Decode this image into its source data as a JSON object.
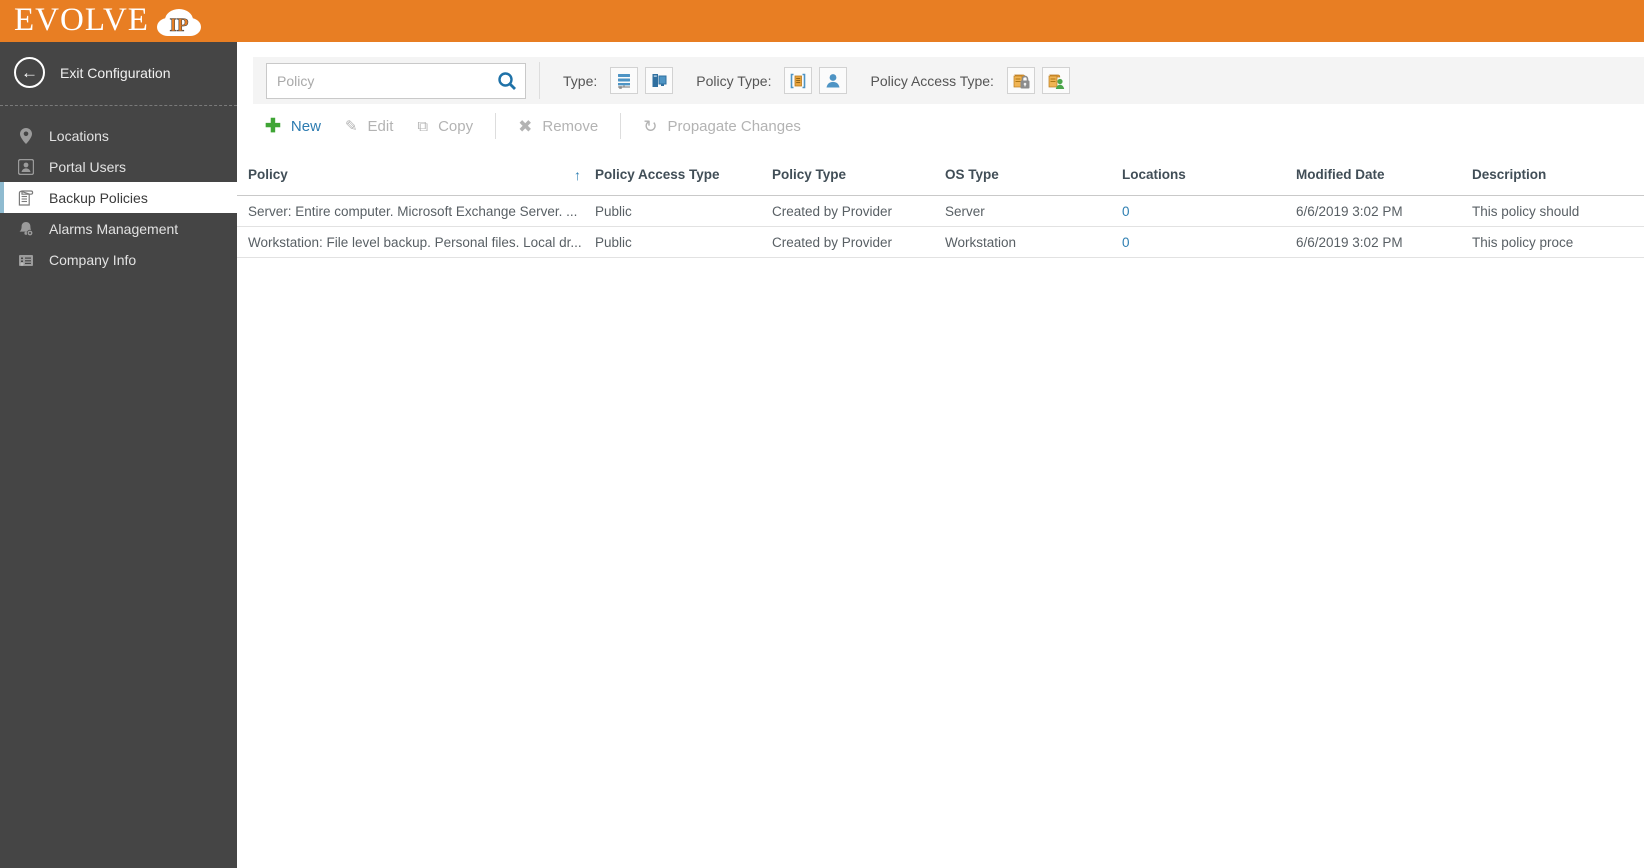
{
  "brand": {
    "logo_text": "EVOLVE",
    "logo_badge": "IP"
  },
  "sidebar": {
    "exit_label": "Exit Configuration",
    "items": [
      {
        "label": "Locations",
        "icon": "location-pin-icon",
        "selected": false
      },
      {
        "label": "Portal Users",
        "icon": "portal-user-icon",
        "selected": false
      },
      {
        "label": "Backup Policies",
        "icon": "scroll-icon",
        "selected": true
      },
      {
        "label": "Alarms Management",
        "icon": "alarm-gear-icon",
        "selected": false
      },
      {
        "label": "Company Info",
        "icon": "building-icon",
        "selected": false
      }
    ]
  },
  "filters": {
    "search_placeholder": "Policy",
    "search_icon": "magnifier-icon",
    "type_label": "Type:",
    "type_icons": [
      "server-icon",
      "workstation-icon"
    ],
    "policy_type_label": "Policy Type:",
    "policy_type_icons": [
      "provider-scroll-icon",
      "user-icon"
    ],
    "policy_access_type_label": "Policy Access Type:",
    "policy_access_type_icons": [
      "scroll-lock-icon",
      "scroll-person-icon"
    ]
  },
  "toolbar": {
    "new_label": "New",
    "edit_label": "Edit",
    "copy_label": "Copy",
    "remove_label": "Remove",
    "propagate_label": "Propagate Changes"
  },
  "table": {
    "columns": [
      "Policy",
      "Policy Access Type",
      "Policy Type",
      "OS Type",
      "Locations",
      "Modified Date",
      "Description"
    ],
    "sort": {
      "column": "Policy Access Type",
      "direction": "asc",
      "glyph": "↑"
    },
    "rows": [
      {
        "policy": "Server: Entire computer. Microsoft Exchange Server. ...",
        "access_type": "Public",
        "policy_type": "Created by Provider",
        "os_type": "Server",
        "locations": "0",
        "modified": "6/6/2019 3:02 PM",
        "description": "This policy should"
      },
      {
        "policy": "Workstation: File level backup. Personal files. Local dr...",
        "access_type": "Public",
        "policy_type": "Created by Provider",
        "os_type": "Workstation",
        "locations": "0",
        "modified": "6/6/2019 3:02 PM",
        "description": "This policy proce"
      }
    ]
  },
  "colors": {
    "brand_orange": "#E87E23",
    "sidebar_dark": "#454545",
    "selected_accent_blue": "#8FBBD0",
    "link_blue": "#2E7FB2",
    "action_green": "#3FA535",
    "disabled_gray": "#B3B3B3",
    "filter_band_gray": "#F4F4F4"
  }
}
